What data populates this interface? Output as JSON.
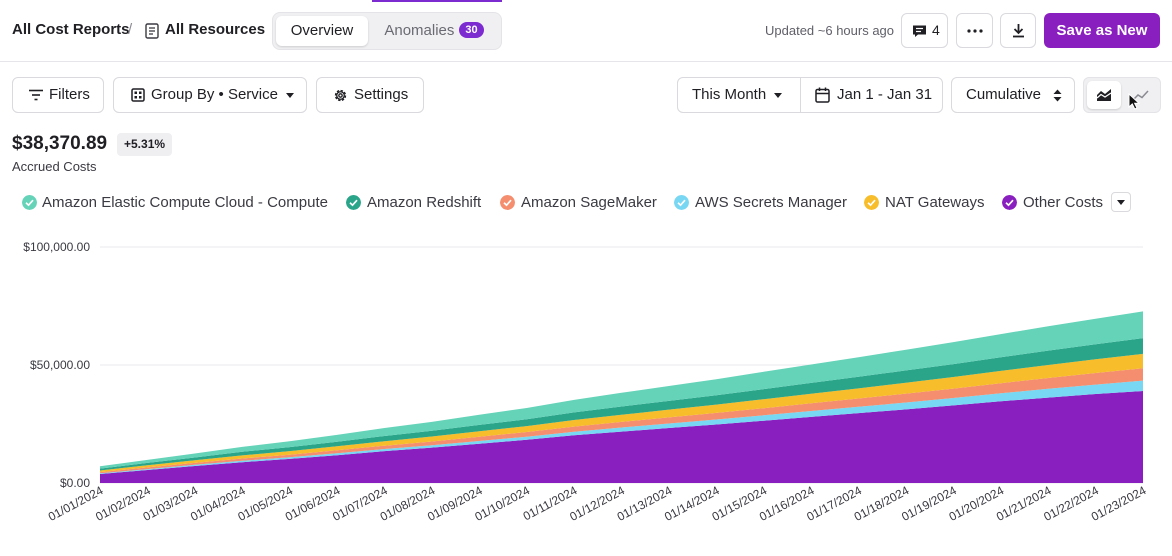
{
  "header": {
    "crumb_reports": "All Cost Reports",
    "crumb_sep": "/",
    "crumb_resources": "All Resources",
    "tab_overview": "Overview",
    "tab_anomalies": "Anomalies",
    "anomalies_count": "30",
    "updated": "Updated ~6 hours ago",
    "comments_count": "4",
    "save_label": "Save as New"
  },
  "toolbar": {
    "filters": "Filters",
    "group_by": "Group By • Service",
    "settings": "Settings",
    "period": "This Month",
    "date_range": "Jan 1 - Jan 31",
    "mode": "Cumulative"
  },
  "summary": {
    "total": "$38,370.89",
    "delta": "+5.31%",
    "label": "Accrued Costs"
  },
  "legend": [
    {
      "name": "Amazon Elastic Compute Cloud - Compute",
      "color": "#64d3b8"
    },
    {
      "name": "Amazon Redshift",
      "color": "#2ba58a"
    },
    {
      "name": "Amazon SageMaker",
      "color": "#f58e6e"
    },
    {
      "name": "AWS Secrets Manager",
      "color": "#78d7f2"
    },
    {
      "name": "NAT Gateways",
      "color": "#f7bd2a"
    },
    {
      "name": "Other Costs",
      "color": "#8a1fc0"
    }
  ],
  "icons": {
    "doc": "document-icon",
    "comment": "comment-icon",
    "more": "more-horizontal-icon",
    "download": "download-icon",
    "filter": "filter-lines-icon",
    "group": "grid-icon",
    "settings": "gear-icon",
    "calendar": "calendar-icon",
    "area": "area-chart-icon",
    "line": "line-chart-icon"
  },
  "chart_data": {
    "type": "area",
    "stacked": true,
    "ylim": [
      0,
      100000
    ],
    "yticks": [
      "$100,000.00",
      "$50,000.00",
      "$0.00"
    ],
    "ytick_values": [
      100000,
      50000,
      0
    ],
    "x": [
      "01/01/2024",
      "01/02/2024",
      "01/03/2024",
      "01/04/2024",
      "01/05/2024",
      "01/06/2024",
      "01/07/2024",
      "01/08/2024",
      "01/09/2024",
      "01/10/2024",
      "01/11/2024",
      "01/12/2024",
      "01/13/2024",
      "01/14/2024",
      "01/15/2024",
      "01/16/2024",
      "01/17/2024",
      "01/18/2024",
      "01/19/2024",
      "01/20/2024",
      "01/21/2024",
      "01/22/2024",
      "01/23/2024"
    ],
    "series": [
      {
        "name": "Other Costs",
        "color": "#8a1fc0",
        "values": [
          3800,
          5500,
          7200,
          8800,
          10200,
          11800,
          13500,
          15000,
          16600,
          18300,
          20200,
          21800,
          23300,
          24800,
          26400,
          28000,
          29600,
          31200,
          32900,
          34600,
          36200,
          37700,
          39000
        ]
      },
      {
        "name": "AWS Secrets Manager",
        "color": "#78d7f2",
        "values": [
          300,
          400,
          500,
          600,
          700,
          800,
          900,
          1000,
          1200,
          1300,
          1500,
          1700,
          1900,
          2100,
          2300,
          2500,
          2700,
          2900,
          3100,
          3400,
          3700,
          4000,
          4400
        ]
      },
      {
        "name": "Amazon SageMaker",
        "color": "#f58e6e",
        "values": [
          500,
          700,
          800,
          1000,
          1100,
          1300,
          1400,
          1600,
          1800,
          2000,
          2200,
          2400,
          2600,
          2800,
          3000,
          3300,
          3500,
          3800,
          4000,
          4300,
          4600,
          4900,
          5200
        ]
      },
      {
        "name": "NAT Gateways",
        "color": "#f7bd2a",
        "values": [
          700,
          900,
          1100,
          1300,
          1500,
          1700,
          1900,
          2100,
          2300,
          2500,
          2800,
          3000,
          3300,
          3500,
          3800,
          4000,
          4300,
          4600,
          4900,
          5200,
          5500,
          5800,
          6100
        ]
      },
      {
        "name": "Amazon Redshift",
        "color": "#2ba58a",
        "values": [
          800,
          1000,
          1200,
          1500,
          1700,
          1900,
          2200,
          2400,
          2700,
          2900,
          3200,
          3500,
          3700,
          4000,
          4300,
          4600,
          4900,
          5200,
          5500,
          5800,
          6100,
          6400,
          6700
        ]
      },
      {
        "name": "Amazon Elastic Compute Cloud - Compute",
        "color": "#64d3b8",
        "values": [
          1000,
          1300,
          1700,
          2100,
          2500,
          2900,
          3400,
          3800,
          4300,
          4800,
          5300,
          5800,
          6300,
          6800,
          7300,
          7800,
          8300,
          8800,
          9300,
          9800,
          10300,
          10800,
          11300
        ]
      }
    ]
  }
}
